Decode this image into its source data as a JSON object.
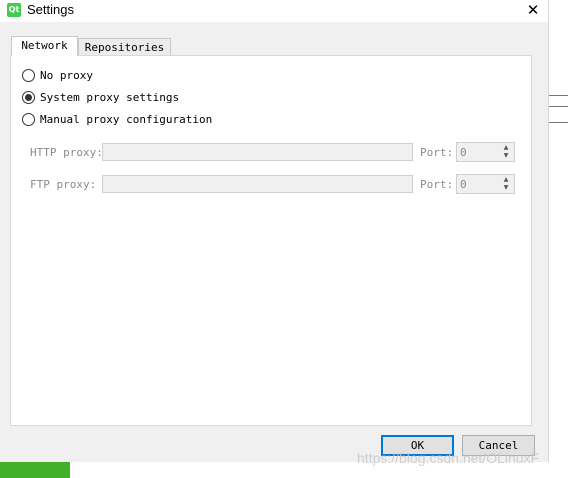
{
  "window": {
    "title": "Settings",
    "app_icon_text": "Qt",
    "close_glyph": "✕"
  },
  "tabs": [
    {
      "label": "Network",
      "active": true
    },
    {
      "label": "Repositories",
      "active": false
    }
  ],
  "network": {
    "proxy_options": [
      {
        "label": "No proxy",
        "checked": false
      },
      {
        "label": "System proxy settings",
        "checked": true
      },
      {
        "label": "Manual proxy configuration",
        "checked": false
      }
    ],
    "http": {
      "label": "HTTP proxy:",
      "value": "",
      "port_label": "Port:",
      "port_value": "0"
    },
    "ftp": {
      "label": "FTP proxy:",
      "value": "",
      "port_label": "Port:",
      "port_value": "0"
    }
  },
  "buttons": {
    "ok": "OK",
    "cancel": "Cancel"
  },
  "icons": {
    "spin_up": "▲",
    "spin_down": "▼"
  },
  "colors": {
    "qt_green": "#41cd52",
    "ok_border": "#0078d7"
  },
  "watermark": "https://blog.csdn.net/OLinuxF"
}
